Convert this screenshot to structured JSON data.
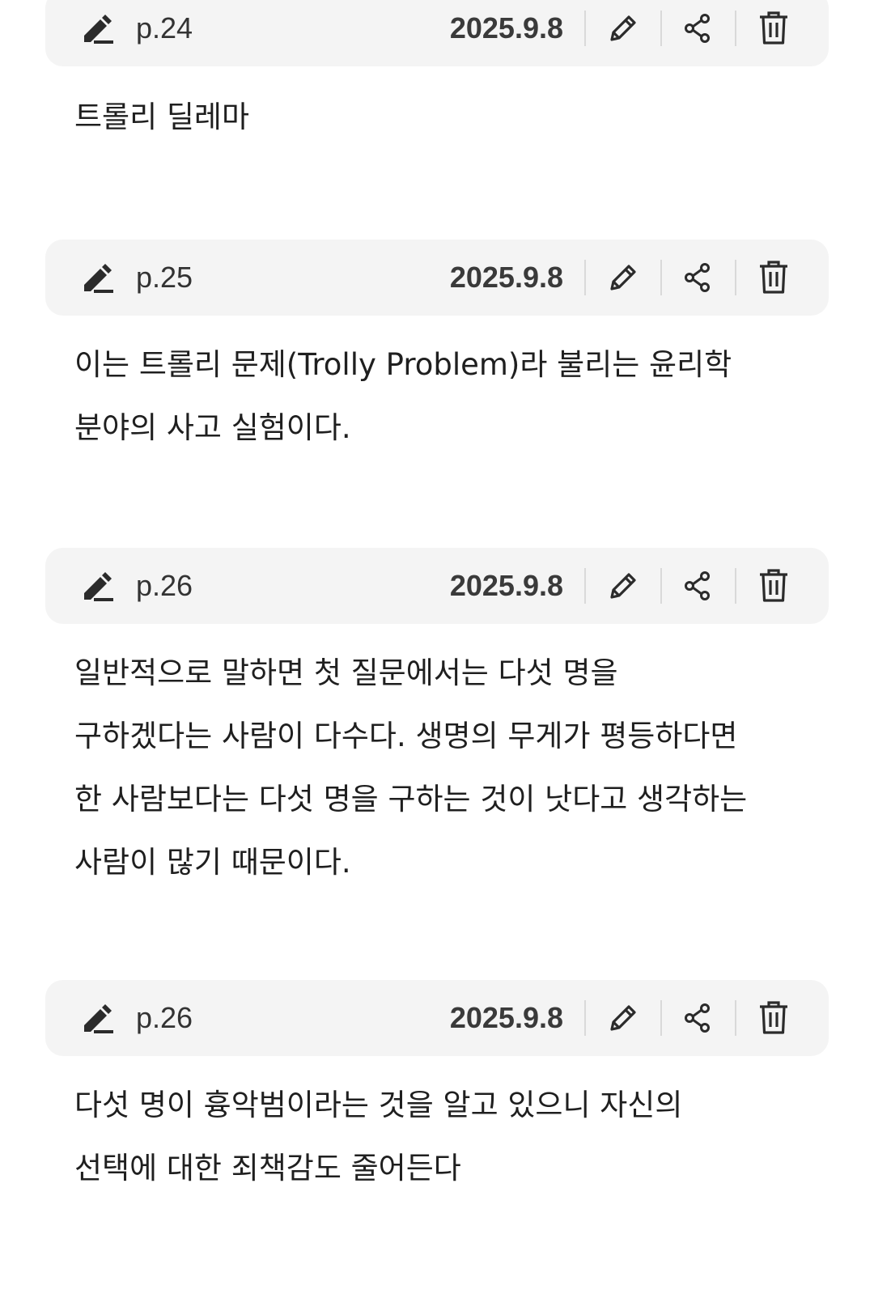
{
  "notes": [
    {
      "page": "p.24",
      "date": "2025.9.8",
      "text": "트롤리 딜레마"
    },
    {
      "page": "p.25",
      "date": "2025.9.8",
      "text": "이는 트롤리 문제(Trolly Problem)라 불리는 윤리학\n분야의 사고 실험이다."
    },
    {
      "page": "p.26",
      "date": "2025.9.8",
      "text": "일반적으로 말하면 첫 질문에서는 다섯 명을\n구하겠다는 사람이 다수다. 생명의 무게가 평등하다면\n한 사람보다는 다섯 명을 구하는 것이 낫다고 생각하는\n사람이 많기 때문이다."
    },
    {
      "page": "p.26",
      "date": "2025.9.8",
      "text": "다섯 명이 흉악범이라는 것을 알고 있으니 자신의\n선택에 대한 죄책감도 줄어든다"
    }
  ],
  "icons": {
    "note": "pen-writing-icon",
    "edit": "pencil-icon",
    "share": "share-icon",
    "delete": "trash-icon"
  },
  "colors": {
    "header_bg": "#f4f4f4",
    "text": "#1f1f1f",
    "icon": "#2b2b2b"
  }
}
